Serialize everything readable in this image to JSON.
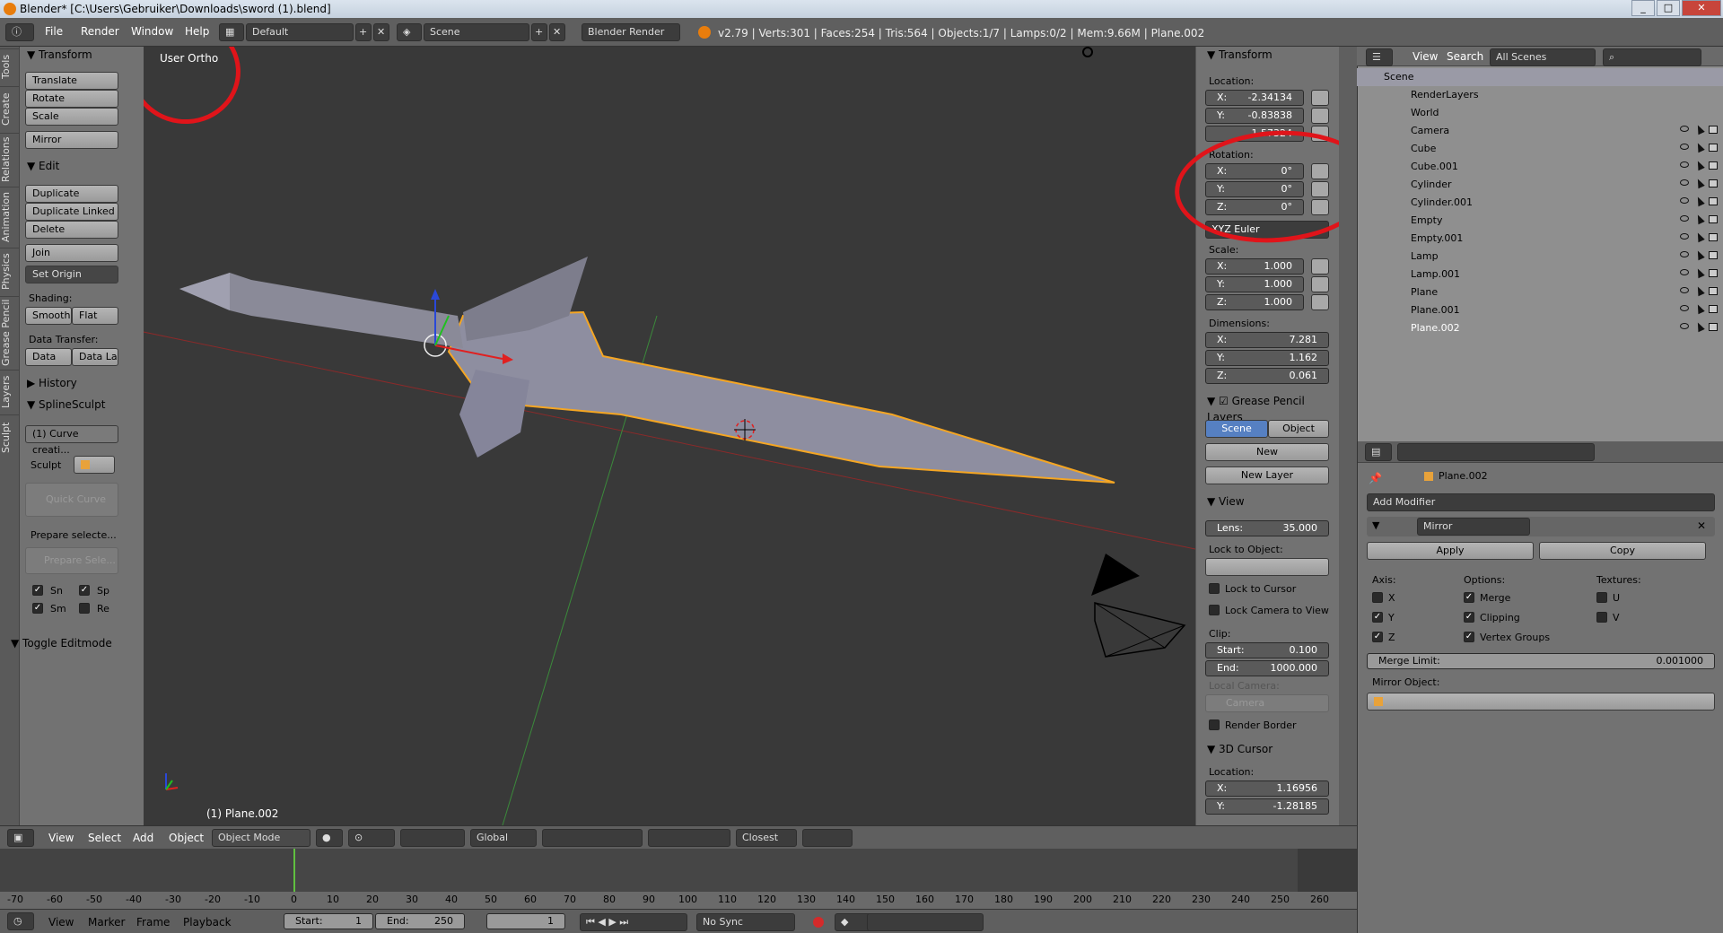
{
  "window": {
    "title": "Blender* [C:\\Users\\Gebruiker\\Downloads\\sword (1).blend]"
  },
  "topbar": {
    "menus": [
      "File",
      "Render",
      "Window",
      "Help"
    ],
    "layout": "Default",
    "scene": "Scene",
    "engine": "Blender Render",
    "stats": "v2.79 | Verts:301 | Faces:254 | Tris:564 | Objects:1/7 | Lamps:0/2 | Mem:9.66M | Plane.002"
  },
  "tool_tabs": [
    "Tools",
    "Create",
    "Relations",
    "Animation",
    "Physics",
    "Grease Pencil",
    "Layers",
    "Sculpt"
  ],
  "toolshelf": {
    "transform_header": "Transform",
    "translate": "Translate",
    "rotate": "Rotate",
    "scale": "Scale",
    "mirror": "Mirror",
    "edit_header": "Edit",
    "duplicate": "Duplicate",
    "duplicate_linked": "Duplicate Linked",
    "delete": "Delete",
    "join": "Join",
    "set_origin": "Set Origin",
    "shading_label": "Shading:",
    "smooth": "Smooth",
    "flat": "Flat",
    "data_transfer_label": "Data Transfer:",
    "data": "Data",
    "data_la": "Data La",
    "history_header": "History",
    "splinesculpt_header": "SplineSculpt",
    "curve_creation": "(1) Curve creati...",
    "sculpt_label": "Sculpt",
    "quick_curve": "Quick Curve",
    "prepare_selected": "Prepare selecte...",
    "prepare_sele": "Prepare Sele...",
    "chk_sn": "Sn",
    "chk_sp": "Sp",
    "chk_sm": "Sm",
    "chk_re": "Re",
    "toggle_editmode": "Toggle Editmode"
  },
  "viewport": {
    "view_name": "User Ortho",
    "active_object": "(1) Plane.002"
  },
  "n_panel": {
    "transform_header": "Transform",
    "location_label": "Location:",
    "loc_x_key": "X:",
    "loc_x": "-2.34134",
    "loc_y_key": "Y:",
    "loc_y": "-0.83838",
    "loc_z": "1.57324",
    "rotation_label": "Rotation:",
    "rot_x_key": "X:",
    "rot_x": "0°",
    "rot_y_key": "Y:",
    "rot_y": "0°",
    "rot_z_key": "Z:",
    "rot_z": "0°",
    "rotation_mode": "XYZ Euler",
    "scale_label": "Scale:",
    "sc_x_key": "X:",
    "sc_x": "1.000",
    "sc_y_key": "Y:",
    "sc_y": "1.000",
    "sc_z_key": "Z:",
    "sc_z": "1.000",
    "dimensions_label": "Dimensions:",
    "dim_x_key": "X:",
    "dim_x": "7.281",
    "dim_y_key": "Y:",
    "dim_y": "1.162",
    "dim_z_key": "Z:",
    "dim_z": "0.061",
    "grease_header": "Grease Pencil Layers",
    "gp_scene": "Scene",
    "gp_object": "Object",
    "gp_new": "New",
    "gp_new_layer": "New Layer",
    "view_header": "View",
    "lens_key": "Lens:",
    "lens": "35.000",
    "lock_to_object": "Lock to Object:",
    "lock_to_cursor": "Lock to Cursor",
    "lock_camera_to_view": "Lock Camera to View",
    "clip_label": "Clip:",
    "clip_start_key": "Start:",
    "clip_start": "0.100",
    "clip_end_key": "End:",
    "clip_end": "1000.000",
    "local_camera": "Local Camera:",
    "camera": "Camera",
    "render_border": "Render Border",
    "cursor_header": "3D Cursor",
    "cursor_location": "Location:",
    "cur_x_key": "X:",
    "cur_x": "1.16956",
    "cur_y_key": "Y:",
    "cur_y": "-1.28185"
  },
  "outliner": {
    "view": "View",
    "search": "Search",
    "filter": "All Scenes",
    "items": [
      {
        "name": "Scene"
      },
      {
        "name": "RenderLayers"
      },
      {
        "name": "World"
      },
      {
        "name": "Camera"
      },
      {
        "name": "Cube"
      },
      {
        "name": "Cube.001"
      },
      {
        "name": "Cylinder"
      },
      {
        "name": "Cylinder.001"
      },
      {
        "name": "Empty"
      },
      {
        "name": "Empty.001"
      },
      {
        "name": "Lamp"
      },
      {
        "name": "Lamp.001"
      },
      {
        "name": "Plane"
      },
      {
        "name": "Plane.001"
      },
      {
        "name": "Plane.002"
      }
    ]
  },
  "properties": {
    "context_object": "Plane.002",
    "add_modifier": "Add Modifier",
    "modifier_name": "Mirror",
    "apply": "Apply",
    "copy": "Copy",
    "axis_label": "Axis:",
    "axis_x": "X",
    "axis_y": "Y",
    "axis_z": "Z",
    "options_label": "Options:",
    "merge": "Merge",
    "clipping": "Clipping",
    "vertex_groups": "Vertex Groups",
    "textures_label": "Textures:",
    "tex_u": "U",
    "tex_v": "V",
    "merge_limit_key": "Merge Limit:",
    "merge_limit": "0.001000",
    "mirror_object": "Mirror Object:"
  },
  "view3d_header": {
    "view": "View",
    "select": "Select",
    "add": "Add",
    "object": "Object",
    "mode": "Object Mode",
    "orientation": "Global",
    "snap": "Closest"
  },
  "timeline": {
    "ticks": [
      "-70",
      "-60",
      "-50",
      "-40",
      "-30",
      "-20",
      "-10",
      "0",
      "10",
      "20",
      "30",
      "40",
      "50",
      "60",
      "70",
      "80",
      "90",
      "100",
      "110",
      "120",
      "130",
      "140",
      "150",
      "160",
      "170",
      "180",
      "190",
      "200",
      "210",
      "220",
      "230",
      "240",
      "250",
      "260"
    ],
    "current_frame_marker": 0,
    "view": "View",
    "marker": "Marker",
    "frame": "Frame",
    "playback": "Playback",
    "start_key": "Start:",
    "start": "1",
    "end_key": "End:",
    "end": "250",
    "current": "1",
    "sync": "No Sync"
  },
  "colors": {
    "annotation": "#e0141a",
    "selection": "#f5a623",
    "active_tab": "#5680c2"
  }
}
